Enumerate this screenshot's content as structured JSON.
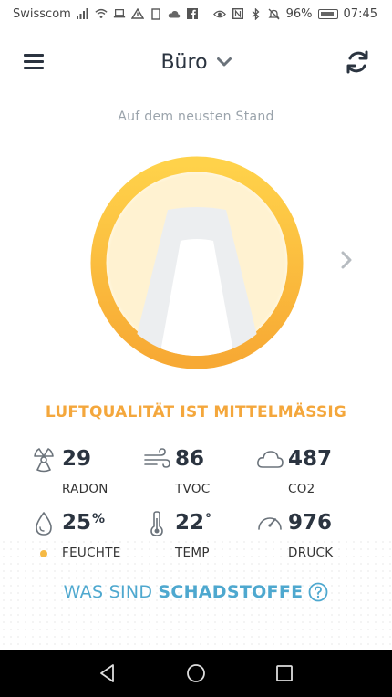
{
  "statusbar": {
    "carrier": "Swisscom",
    "battery": "96%",
    "time": "07:45"
  },
  "header": {
    "location": "Büro"
  },
  "status_text": "Auf dem neusten Stand",
  "quality_text": "LUFTQUALITÄT IST MITTELMÄSSIG",
  "metrics": {
    "radon": {
      "value": "29",
      "unit": "",
      "label": "RADON"
    },
    "tvoc": {
      "value": "86",
      "unit": "",
      "label": "TVOC"
    },
    "co2": {
      "value": "487",
      "unit": "",
      "label": "CO2"
    },
    "feuchte": {
      "value": "25",
      "unit": "%",
      "label": "FEUCHTE"
    },
    "temp": {
      "value": "22",
      "unit": "°",
      "label": "TEMP"
    },
    "druck": {
      "value": "976",
      "unit": "",
      "label": "DRUCK"
    }
  },
  "footer": {
    "prefix": "WAS SIND",
    "link": "SCHADSTOFFE"
  },
  "colors": {
    "accent_orange": "#f4a73c",
    "ring_top": "#ffd24a",
    "ring_bottom": "#f7a934",
    "link_blue": "#4ea8cf",
    "text_dark": "#2b3440"
  },
  "icons": {
    "menu": "menu-icon",
    "sync": "sync-icon",
    "radon": "radiation-icon",
    "tvoc": "wind-icon",
    "co2": "cloud-icon",
    "humidity": "droplet-icon",
    "temperature": "thermometer-icon",
    "pressure": "gauge-icon",
    "help": "help-icon"
  }
}
